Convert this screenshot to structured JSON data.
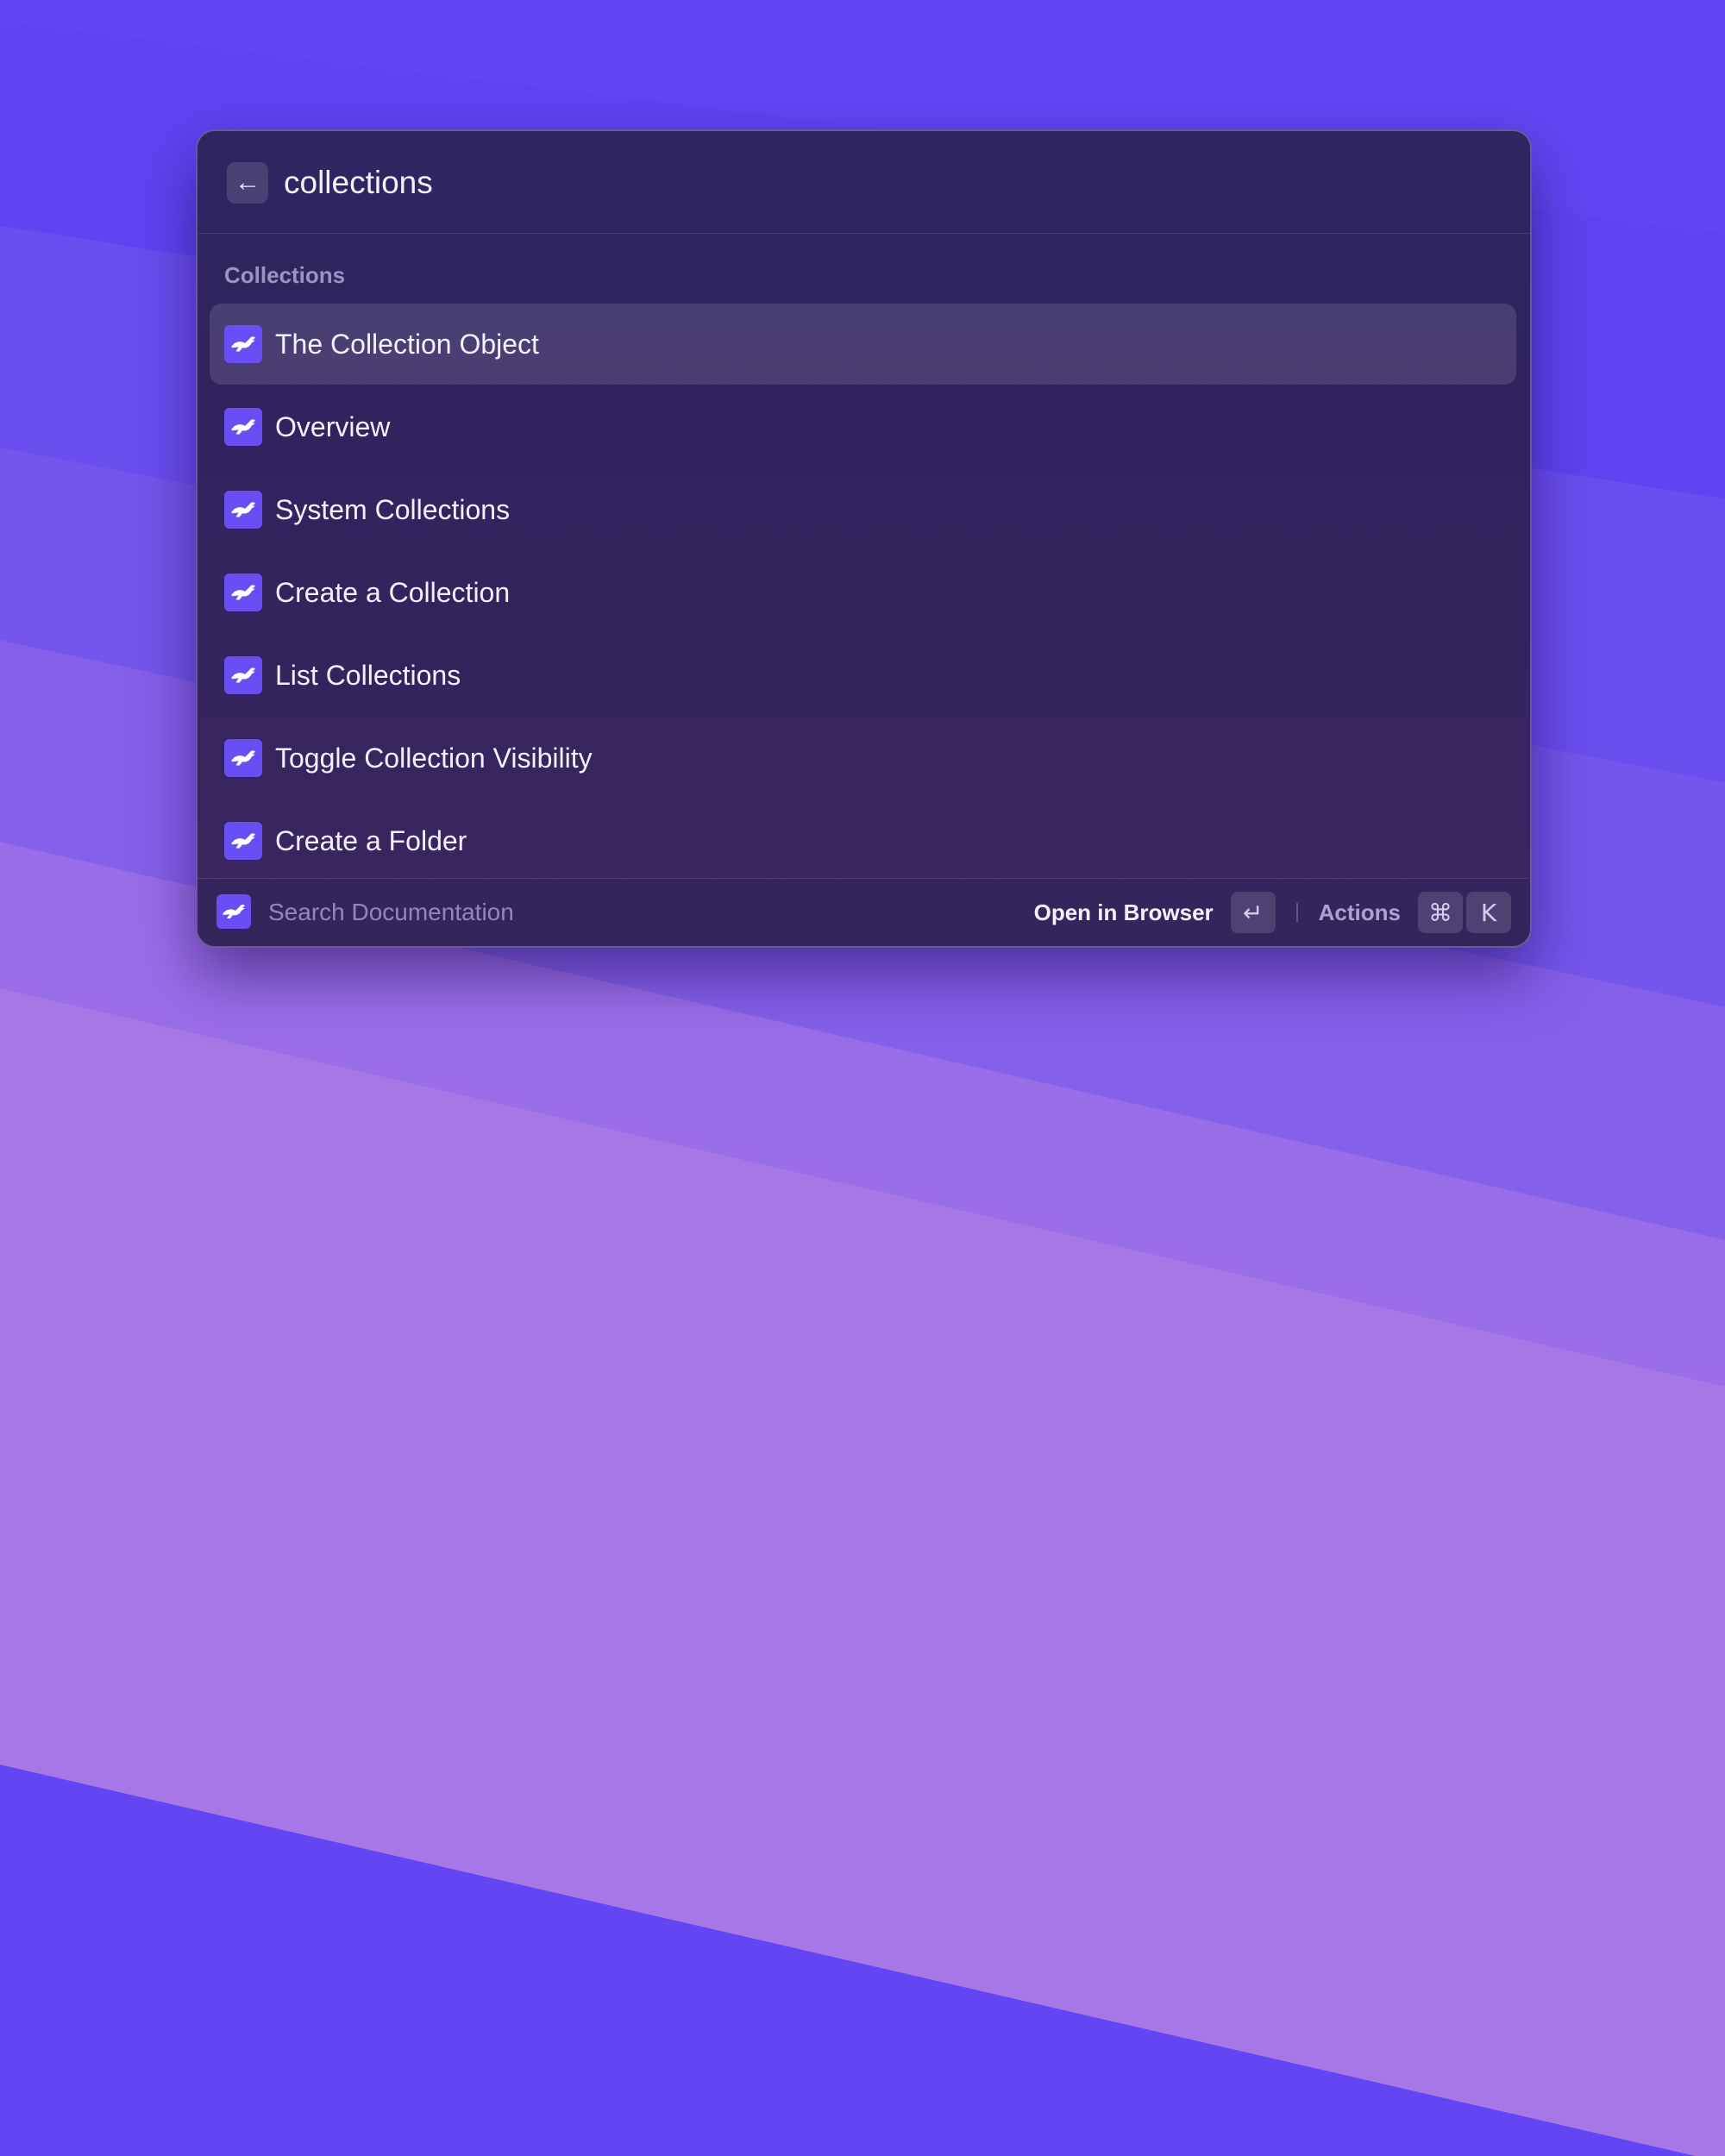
{
  "search": {
    "back_icon": "arrow-left-icon",
    "query": "collections"
  },
  "section": {
    "label": "Collections"
  },
  "results": [
    {
      "label": "The Collection Object",
      "icon": "directus-rabbit-icon",
      "selected": true
    },
    {
      "label": "Overview",
      "icon": "directus-rabbit-icon"
    },
    {
      "label": "System Collections",
      "icon": "directus-rabbit-icon"
    },
    {
      "label": "Create a Collection",
      "icon": "directus-rabbit-icon"
    },
    {
      "label": "List Collections",
      "icon": "directus-rabbit-icon"
    },
    {
      "label": "Toggle Collection Visibility",
      "icon": "directus-rabbit-icon"
    },
    {
      "label": "Create a Folder",
      "icon": "directus-rabbit-icon"
    }
  ],
  "footer": {
    "command_title": "Search Documentation",
    "primary_action": "Open in Browser",
    "primary_key": "↵",
    "actions_label": "Actions",
    "actions_keys": [
      "⌘",
      "K"
    ]
  },
  "colors": {
    "background": "#6246f4",
    "accent": "#6a4ef5",
    "window": "#2f2560"
  }
}
